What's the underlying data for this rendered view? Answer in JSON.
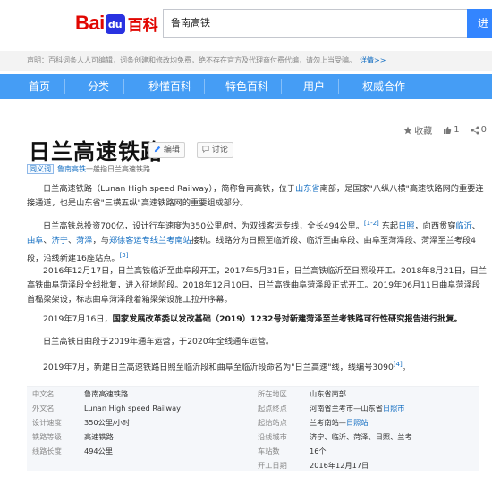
{
  "header": {
    "logo_bai": "Bai",
    "logo_du": "du",
    "logo_baike": "百科",
    "search_value": "鲁南高铁",
    "search_button": "进"
  },
  "notice": {
    "text": "声明：百科词条人人可编辑，词条创建和修改均免费，绝不存在官方及代理商付费代编，请勿上当受骗。",
    "more": "详情>>"
  },
  "nav": {
    "items": [
      "首页",
      "分类",
      "秒懂百科",
      "特色百科",
      "用户",
      "权威合作"
    ]
  },
  "tools": {
    "favorite": "收藏",
    "like_count": "1",
    "share_count": "0"
  },
  "article": {
    "title": "日兰高速铁路",
    "edit": "编辑",
    "discuss": "讨论",
    "polysemy_tag": "同义词",
    "polysemy_link": "鲁南高铁",
    "polysemy_text": "一般指日兰高速铁路",
    "p1_a": "日兰高速铁路（Lunan High speed Railway），简称鲁南高铁，位于",
    "p1_link": "山东省",
    "p1_b": "南部，是国家\"八纵八横\"高速铁路网的重要连接通道，也是山东省\"三横五纵\"高速铁路网的重要组成部分。",
    "p2_a": "日兰高铁总投资700亿，设计行车速度为350公里/时，为双线客运专线，全长494公里。",
    "p2_sup1": "[1-2]",
    "p2_b": " 东起",
    "p2_l1": "日照",
    "p2_c": "，向西贯穿",
    "p2_l2": "临沂",
    "p2_d": "、",
    "p2_l3": "曲阜",
    "p2_e": "、",
    "p2_l4": "济宁",
    "p2_f": "、",
    "p2_l5": "菏泽",
    "p2_g": "，与",
    "p2_l6": "郑徐客运专线",
    "p2_l7": "兰考南站",
    "p2_h": "接轨。线路分为日照至临沂段、临沂至曲阜段、曲阜至菏泽段、菏泽至兰考段4段，沿线新建16座站点。",
    "p2_sup2": "[3]",
    "p3": "2016年12月17日，日兰高铁临沂至曲阜段开工，2017年5月31日，日兰高铁临沂至日照段开工。2018年8月21日，日兰高铁曲阜菏泽段全线批复，进入征地阶段。2018年12月10日，日兰高铁曲阜菏泽段正式开工。2019年06月11日曲阜菏泽段首榀梁架设，标志曲阜菏泽段着箱梁架设施工拉开序幕。",
    "p4_a": "2019年7月16日，",
    "p4_bold": "国家发展改革委以发改基础（2019）1232号对新建菏泽至兰考铁路可行性研究报告进行批复。",
    "p5": "日兰高铁日曲段于2019年通车运营，于2020年全线通车运营。",
    "p6_a": "2019年7月，新建日兰高速铁路日照至临沂段和曲阜至临沂段命名为\"日兰高速\"线，线编号3090",
    "p6_sup": "[4]",
    "p6_b": "。"
  },
  "infobox": {
    "rows": [
      {
        "k1": "中文名",
        "v1": "鲁南高速铁路",
        "k2": "所在地区",
        "v2": "山东省南部"
      },
      {
        "k1": "外文名",
        "v1": "Lunan High speed Railway",
        "k2": "起点终点",
        "v2_a": "河南省兰考市—山东省",
        "v2_link": "日照市"
      },
      {
        "k1": "设计速度",
        "v1": "350公里/小时",
        "k2": "起始站点",
        "v2_a": "兰考南站—",
        "v2_link": "日照站"
      },
      {
        "k1": "铁路等级",
        "v1": "高速铁路",
        "k2": "沿线城市",
        "v2": "济宁、临沂、菏泽、日照、兰考"
      },
      {
        "k1": "线路长度",
        "v1": "494公里",
        "k2": "车站数",
        "v2": "16个"
      },
      {
        "k1": "",
        "v1": "",
        "k2": "开工日期",
        "v2": "2016年12月17日"
      }
    ]
  }
}
